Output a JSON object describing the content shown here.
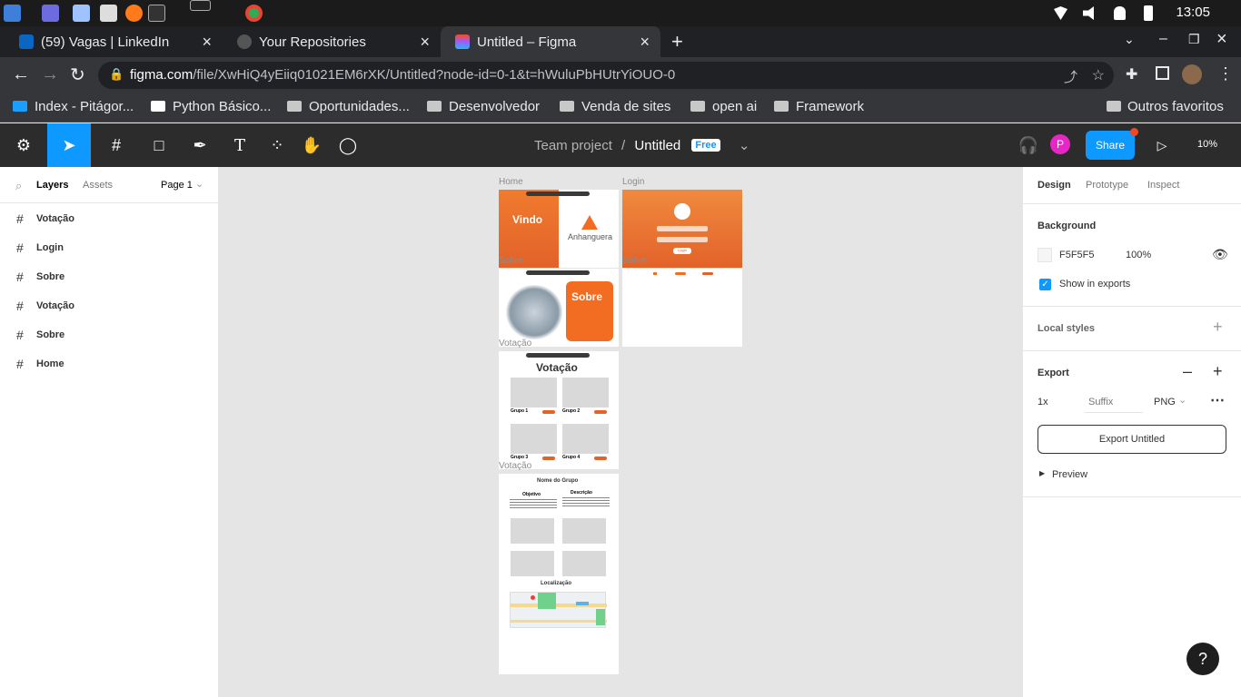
{
  "os": {
    "time": "13:05"
  },
  "browser": {
    "tabs": [
      {
        "label": "(59) Vagas | LinkedIn",
        "active": false
      },
      {
        "label": "Your Repositories",
        "active": false
      },
      {
        "label": "Untitled – Figma",
        "active": true
      }
    ],
    "url_host": "figma.com",
    "url_path": "/file/XwHiQ4yEiiq01021EM6rXK/Untitled?node-id=0-1&t=hWuluPbHUtrYiOUO-0",
    "bookmarks": [
      "Index - Pitágor...",
      "Python Básico...",
      "Oportunidades...",
      "Desenvolvedor",
      "Venda de sites",
      "open ai",
      "Framework"
    ],
    "other_bookmarks": "Outros favoritos"
  },
  "figma": {
    "team": "Team project",
    "file": "Untitled",
    "plan": "Free",
    "share": "Share",
    "zoom": "10%",
    "avatar": "P",
    "left": {
      "tabs": [
        "Layers",
        "Assets"
      ],
      "page": "Page 1",
      "layers": [
        "Votação",
        "Login",
        "Sobre",
        "Votação",
        "Sobre",
        "Home"
      ]
    },
    "canvas": {
      "labels": {
        "home": "Home",
        "login": "Login",
        "sobre1": "Sobre",
        "sobre2": "Sobre",
        "votacao1": "Votação",
        "votacao2": "Votação"
      },
      "home_title": "Vindo",
      "home_brand": "Anhanguera",
      "login_btn": "Login",
      "sobre_title": "Sobre",
      "votacao_title": "Votação",
      "groups": [
        "Grupo 1",
        "Grupo 2",
        "Grupo 3",
        "Grupo 4"
      ],
      "group_detail": "Nome do Grupo",
      "objetivo": "Objetivo",
      "descricao": "Descrição",
      "localizacao": "Localização"
    },
    "right": {
      "tabs": [
        "Design",
        "Prototype",
        "Inspect"
      ],
      "background_label": "Background",
      "bg_hex": "F5F5F5",
      "bg_opacity": "100%",
      "show_exports": "Show in exports",
      "local_styles": "Local styles",
      "export_label": "Export",
      "export_scale": "1x",
      "export_suffix_placeholder": "Suffix",
      "export_format": "PNG",
      "export_button": "Export Untitled",
      "preview": "Preview"
    },
    "help": "?"
  },
  "colors": {
    "accent": "#0d99ff",
    "orange": "#f26d21",
    "orange_dark": "#e05a1a"
  }
}
